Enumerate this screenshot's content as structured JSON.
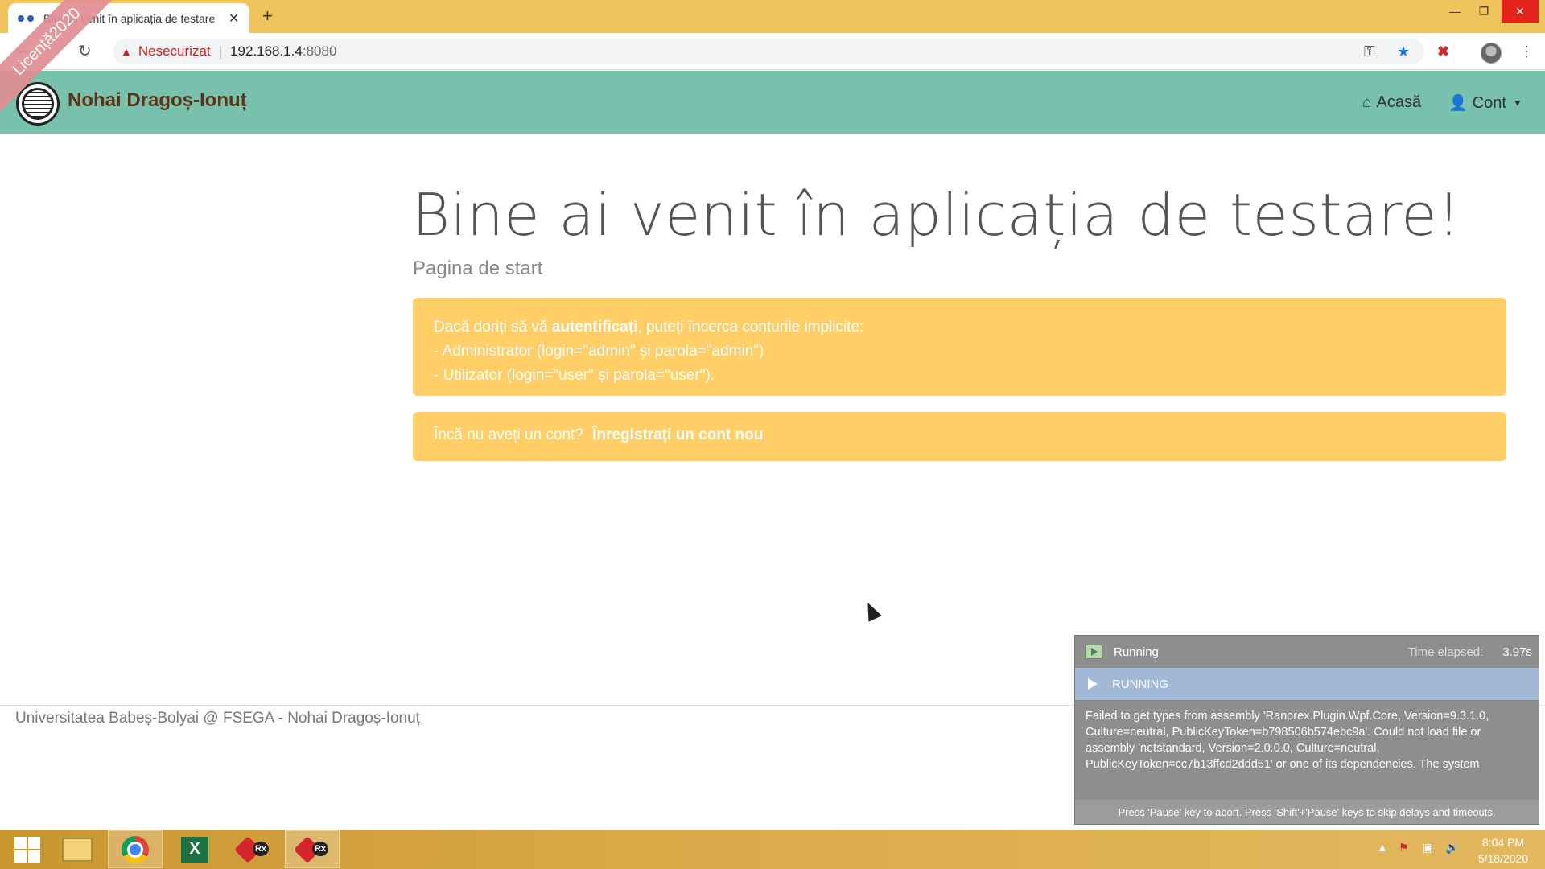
{
  "browser": {
    "tab_title": "Bine ai venit în aplicația de testare",
    "new_tab": "+",
    "security_label": "Nesecurizat",
    "url_host": "192.168.1.4",
    "url_port": ":8080"
  },
  "app": {
    "brand": "Nohai Dragoș-Ionuț",
    "ribbon": "Licență2020",
    "nav": {
      "home": "Acasă",
      "account": "Cont"
    }
  },
  "main": {
    "title": "Bine ai venit în aplicația de testare!",
    "subtitle": "Pagina de start",
    "alert1": {
      "prefix": "Dacă doriți să vă ",
      "bold": "autentificați",
      "suffix": ", puteți încerca conturile implicite:",
      "line2": "- Administrator (login=\"admin\" și parola=\"admin\")",
      "line3": "- Utilizator (login=\"user\" și parola=\"user\")."
    },
    "alert2": {
      "text": "Încă nu aveți un cont? ",
      "link": "Înregistrați un cont nou"
    }
  },
  "footer": {
    "text": "Universitatea Babeș-Bolyai @ FSEGA - Nohai Dragoș-Ionuț"
  },
  "runner": {
    "status": "Running",
    "elapsed_label": "Time elapsed:",
    "elapsed_value": "3.97s",
    "bar_label": "RUNNING",
    "message": "Failed to get types from assembly 'Ranorex.Plugin.Wpf.Core, Version=9.3.1.0, Culture=neutral, PublicKeyToken=b798506b574ebc9a'. Could not load file or assembly 'netstandard, Version=2.0.0.0, Culture=neutral, PublicKeyToken=cc7b13ffcd2ddd51' or one of its dependencies. The system",
    "footer": "Press 'Pause' key to abort. Press 'Shift'+'Pause' keys to skip delays and timeouts."
  },
  "taskbar": {
    "time": "8:04 PM",
    "date": "5/18/2020",
    "excel_letter": "X",
    "rx_label": "Rx"
  },
  "colors": {
    "navbar": "#78c2ad",
    "alert": "#ffce67",
    "brand": "#5b3318",
    "ribbon": "#e18f95"
  }
}
